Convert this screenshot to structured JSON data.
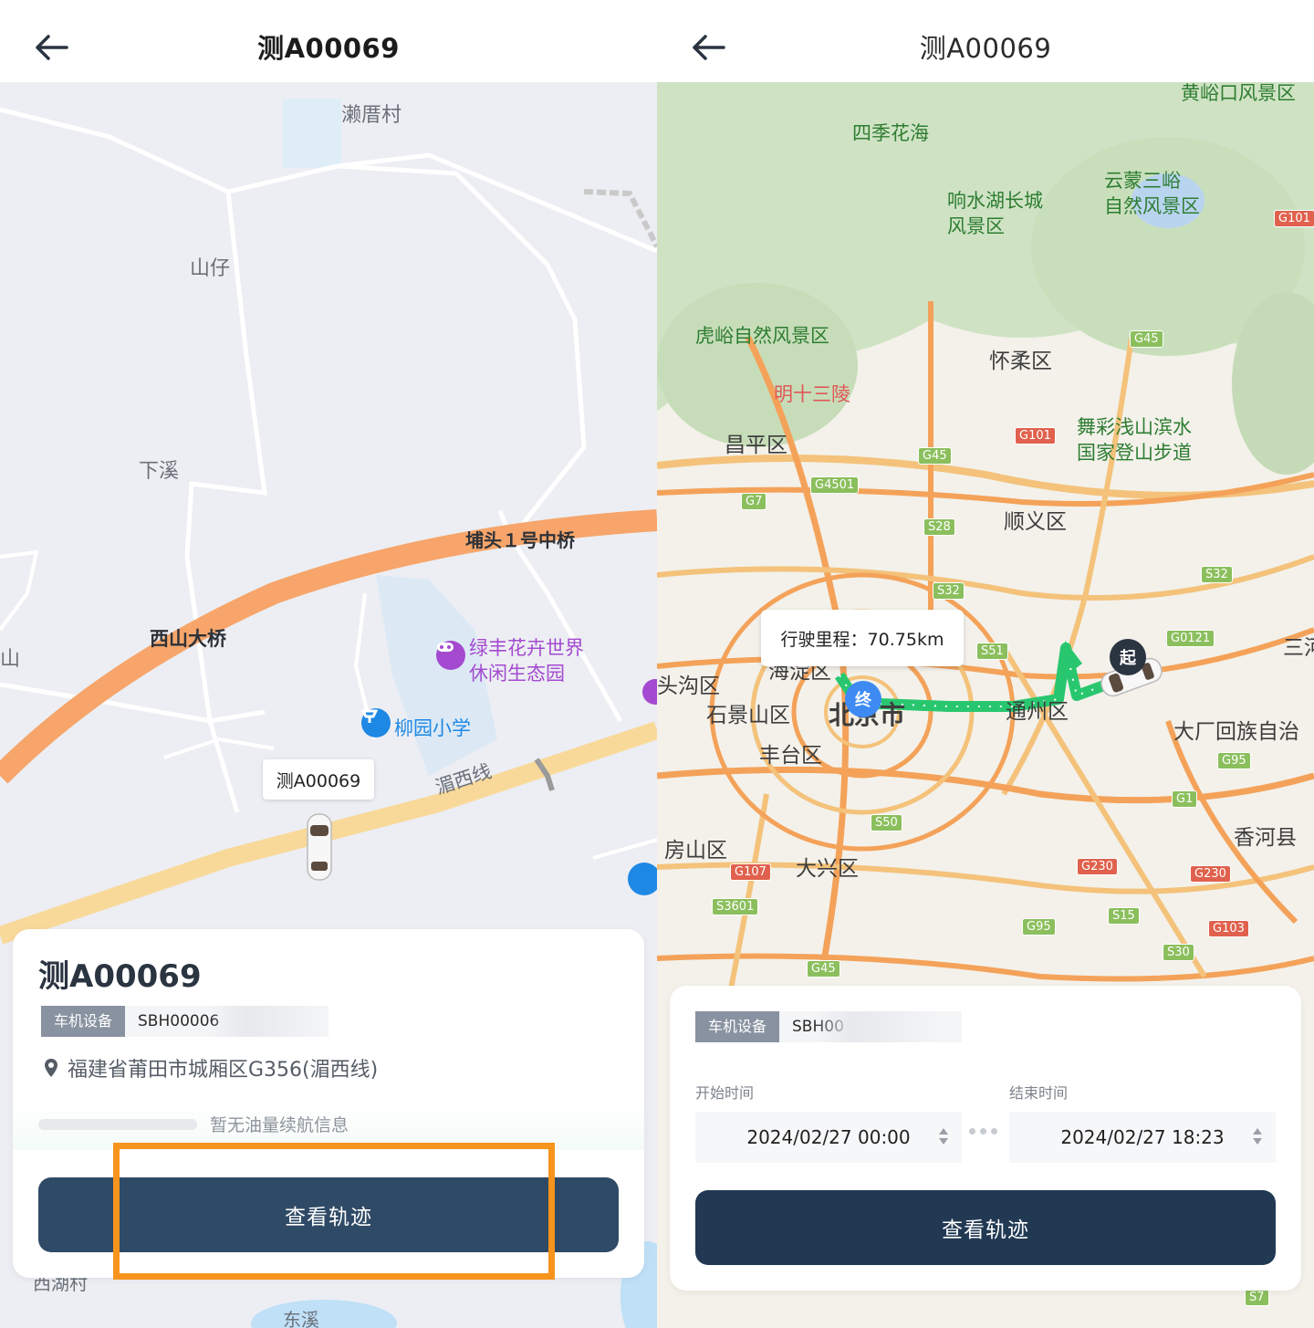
{
  "left": {
    "header": {
      "title": "测A00069"
    },
    "map_labels": {
      "village1": "濑厝村",
      "village2": "山仔",
      "village3": "下溪",
      "bridge1": "埔头１号中桥",
      "bridge2": "西山大桥",
      "poi_park_line1": "绿丰花卉世界",
      "poi_park_line2": "休闲生态园",
      "poi_school": "柳园小学",
      "road": "湄西线",
      "edge_label": "山",
      "bottom_label": "西湖村",
      "bottom_label2": "东溪"
    },
    "car_label": "测A00069",
    "card": {
      "plate": "测A00069",
      "device_tag": "车机设备",
      "device_value": "SBH00006",
      "address": "福建省莆田市城厢区G356(湄西线)",
      "fuel_text": "暂无油量续航信息",
      "button": "查看轨迹"
    }
  },
  "right": {
    "header": {
      "title": "测A00069"
    },
    "map_labels": {
      "huangyakou": "黄峪口风景区",
      "siji": "四季花海",
      "yunmeng_line1": "云蒙三峪",
      "yunmeng_line2": "自然风景区",
      "xiangshui_line1": "响水湖长城",
      "xiangshui_line2": "风景区",
      "huyu": "虎峪自然风景区",
      "ming": "明十三陵",
      "huairou": "怀柔区",
      "changping": "昌平区",
      "wucai_line1": "舞彩浅山滨水",
      "wucai_line2": "国家登山步道",
      "shunyi": "顺义区",
      "haidian": "海淀区",
      "mentougou": "头沟区",
      "shijingshan": "石景山区",
      "beijing": "北京市",
      "tongzhou": "通州区",
      "fengtai": "丰台区",
      "dachang": "大厂回族自治",
      "xianghe": "香河县",
      "fangshan": "房山区",
      "daxing": "大兴区",
      "san": "三河"
    },
    "road_badges": [
      "G101",
      "G45",
      "G101",
      "G45",
      "G4501",
      "G7",
      "S28",
      "S32",
      "S51",
      "G0121",
      "S32",
      "G95",
      "G1",
      "S50",
      "G230",
      "G230",
      "G107",
      "S3601",
      "S15",
      "G95",
      "G103",
      "S30",
      "G45",
      "S7"
    ],
    "tooltip": "行驶里程：70.75km",
    "start_marker": "起",
    "end_marker": "终",
    "card": {
      "device_tag": "车机设备",
      "device_value": "SBH00",
      "start_label": "开始时间",
      "end_label": "结束时间",
      "start_time": "2024/02/27 00:00",
      "end_time": "2024/02/27 18:23",
      "button": "查看轨迹"
    }
  },
  "colors": {
    "button": "#2f4a66",
    "highlight": "#f7941d",
    "route": "#28c76f",
    "orange_road": "#f4a259"
  }
}
